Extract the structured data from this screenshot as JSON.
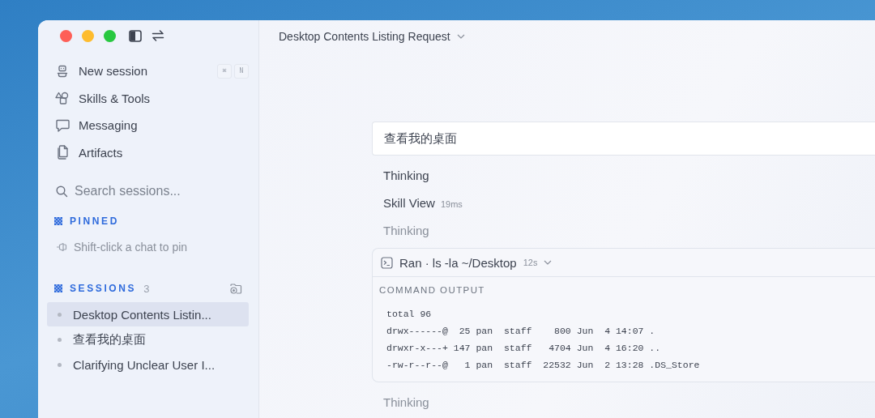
{
  "sidebar": {
    "nav": [
      {
        "label": "New session",
        "shortcut": [
          "⌘",
          "N"
        ]
      },
      {
        "label": "Skills & Tools"
      },
      {
        "label": "Messaging"
      },
      {
        "label": "Artifacts"
      }
    ],
    "search": {
      "placeholder": "Search sessions..."
    },
    "pinned": {
      "title": "PINNED",
      "hint": "Shift-click a chat to pin"
    },
    "sessions": {
      "title": "SESSIONS",
      "count": "3",
      "items": [
        {
          "title": "Desktop Contents Listin...",
          "selected": true
        },
        {
          "title": "查看我的桌面",
          "selected": false
        },
        {
          "title": "Clarifying Unclear User I...",
          "selected": false
        }
      ]
    }
  },
  "main": {
    "title": "Desktop Contents Listing Request",
    "user_message": "查看我的桌面",
    "steps": [
      {
        "kind": "thinking",
        "label": "Thinking",
        "muted": false
      },
      {
        "kind": "tool",
        "label": "Skill View",
        "duration": "19ms"
      },
      {
        "kind": "thinking",
        "label": "Thinking",
        "muted": true
      },
      {
        "kind": "command",
        "label": "Ran · ls -la ~/Desktop",
        "duration": "12s",
        "expanded": true,
        "output_title": "COMMAND OUTPUT",
        "output": [
          "total 96",
          "drwx------@  25 pan  staff    800 Jun  4 14:07 .",
          "drwxr-x---+ 147 pan  staff   4704 Jun  4 16:20 ..",
          "-rw-r--r--@   1 pan  staff  22532 Jun  2 13:28 .DS_Store"
        ]
      },
      {
        "kind": "thinking",
        "label": "Thinking",
        "muted": true
      }
    ]
  }
}
